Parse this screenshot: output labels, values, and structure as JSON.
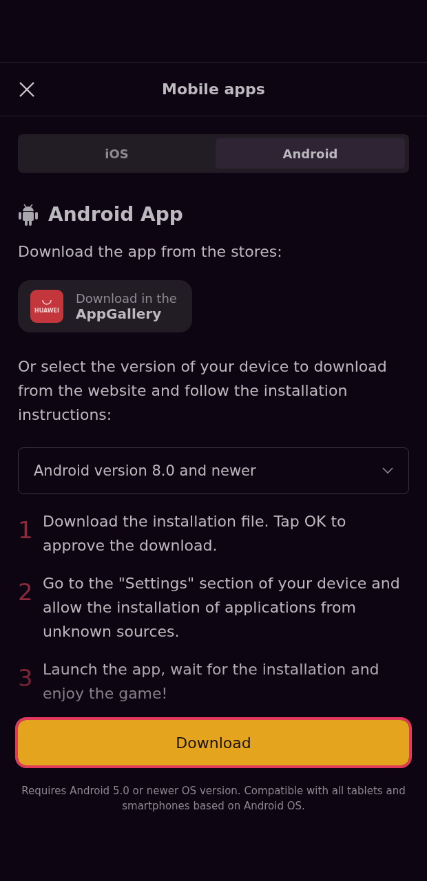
{
  "header": {
    "title": "Mobile apps"
  },
  "tabs": [
    {
      "label": "iOS",
      "selected": false
    },
    {
      "label": "Android",
      "selected": true
    }
  ],
  "section": {
    "title": "Android App",
    "intro": "Download the app from the stores:"
  },
  "store_badge": {
    "logo_text": "HUAWEI",
    "line_1": "Download in the",
    "line_2": "AppGallery"
  },
  "instructions": "Or select the version of your device to download from the website and follow the installation instructions:",
  "version_select": {
    "value": "Android version 8.0 and newer"
  },
  "steps": [
    {
      "number": "1",
      "text": "Download the installation file. Tap OK to approve the download."
    },
    {
      "number": "2",
      "text": "Go to the \"Settings\" section of your device and allow the installation of applications from unknown sources."
    },
    {
      "number": "3",
      "text": "Launch the app, wait for the installation and enjoy the game!"
    }
  ],
  "download_button": {
    "label": "Download",
    "focused": true
  },
  "footnote": "Requires Android 5.0 or newer OS version. Compatible with all tablets and smartphones based on Android OS."
}
